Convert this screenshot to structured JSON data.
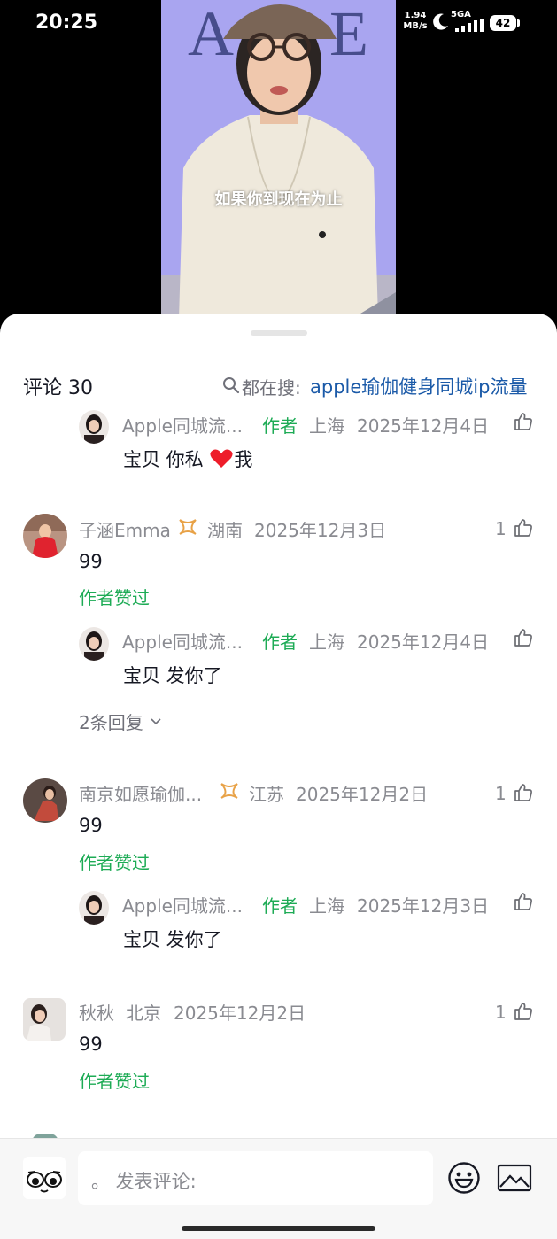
{
  "status_bar": {
    "time": "20:25",
    "net_speed_value": "1.94",
    "net_speed_unit": "MB/s",
    "network": "5GA",
    "battery": "42"
  },
  "video": {
    "subtitle": "如果你到现在为止"
  },
  "header": {
    "count_label": "评论 30",
    "search_prefix": "都在搜:",
    "search_query": "apple瑜伽健身同城ip流量"
  },
  "comments": [
    {
      "reply": {
        "name": "Apple同城流...",
        "badge": "作者",
        "location": "上海",
        "date": "2025年12月4日",
        "text": "宝贝 你私",
        "text_after": "我"
      }
    },
    {
      "name": "子涵Emma",
      "location": "湖南",
      "date": "2025年12月3日",
      "likes": "1",
      "text": "99",
      "author_liked": "作者赞过",
      "reply": {
        "name": "Apple同城流...",
        "badge": "作者",
        "location": "上海",
        "date": "2025年12月4日",
        "text": "宝贝 发你了"
      },
      "more_replies": "2条回复"
    },
    {
      "name": "南京如愿瑜伽...",
      "location": "江苏",
      "date": "2025年12月2日",
      "likes": "1",
      "text": "99",
      "author_liked": "作者赞过",
      "reply": {
        "name": "Apple同城流...",
        "badge": "作者",
        "location": "上海",
        "date": "2025年12月3日",
        "text": "宝贝 发你了"
      }
    },
    {
      "name": "秋秋",
      "location": "北京",
      "date": "2025年12月2日",
      "likes": "1",
      "text": "99",
      "author_liked": "作者赞过"
    }
  ],
  "bottom_bar": {
    "placeholder": "。 发表评论:"
  },
  "colors": {
    "accent_green": "#1dab55",
    "link_blue": "#1b5aa8",
    "muted": "#8a8b91",
    "heart": "#ee1d2a",
    "vip_badge": "#e8a247"
  },
  "icons": [
    "moon-icon",
    "signal-icon",
    "search-icon",
    "thumbs-up-icon",
    "heart-icon",
    "vip-badge-icon",
    "chevron-down-icon",
    "emoji-icon",
    "image-icon",
    "sticker-icon"
  ]
}
